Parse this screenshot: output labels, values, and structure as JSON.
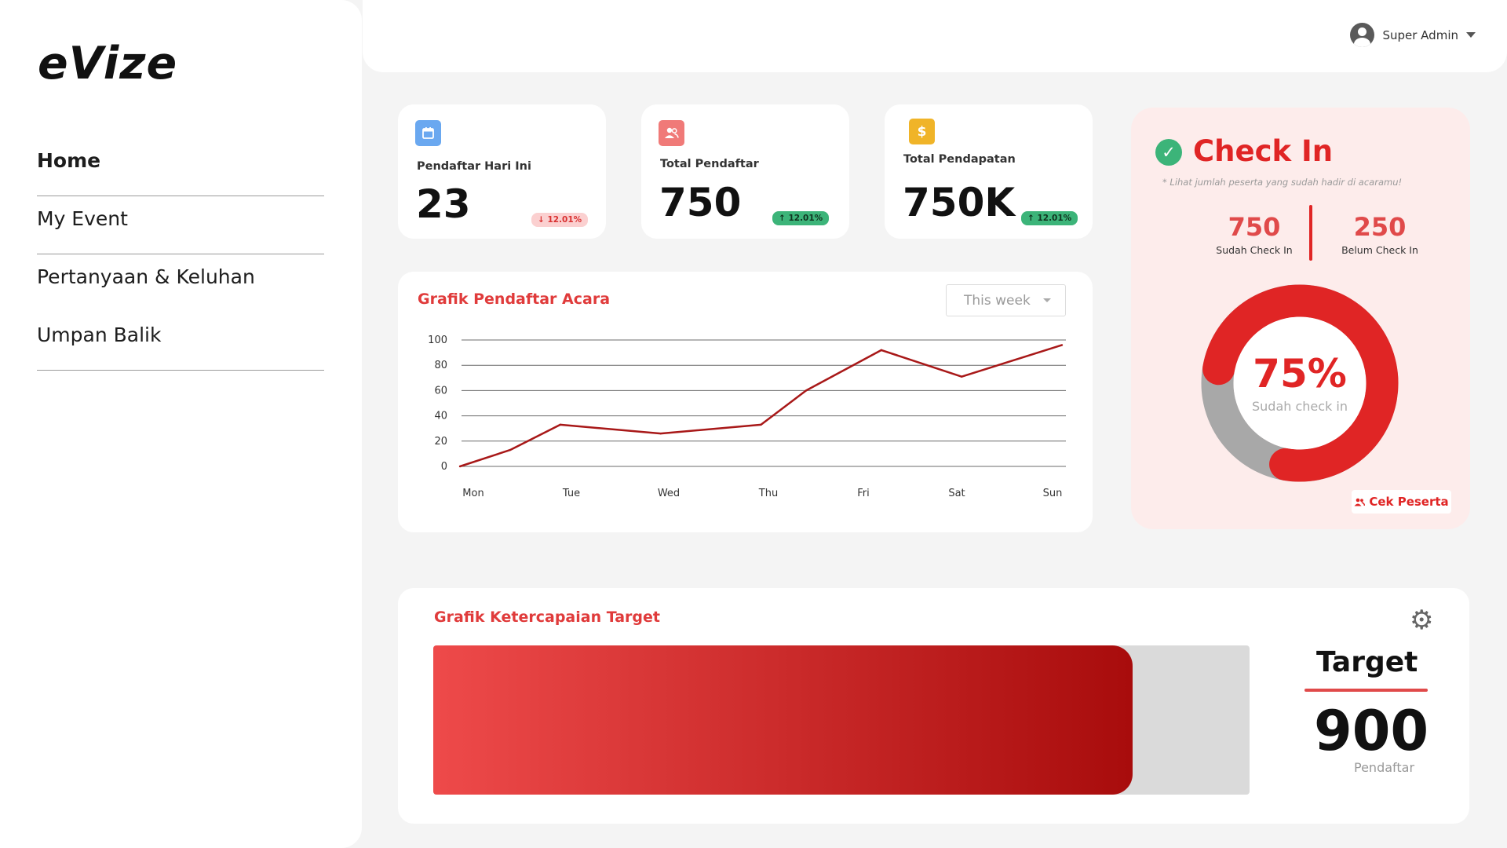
{
  "brand": {
    "logo": "eVize"
  },
  "sidebar": {
    "items": [
      {
        "label": "Home"
      },
      {
        "label": "My Event"
      },
      {
        "label": "Pertanyaan & Keluhan"
      },
      {
        "label": "Umpan Balik"
      }
    ]
  },
  "topbar": {
    "user_name": "Super Admin"
  },
  "stats": [
    {
      "label": "Pendaftar Hari Ini",
      "value": "23",
      "change": "↓ 12.01%",
      "icon": "calendar-icon",
      "color": "#6aa8f0"
    },
    {
      "label": "Total Pendaftar",
      "value": "750",
      "change": "↑ 12.01%",
      "icon": "users-icon",
      "color": "#f07a78"
    },
    {
      "label": "Total Pendapatan",
      "value": "750K",
      "change": "↑ 12.01%",
      "icon": "dollar-icon",
      "color": "#f0b428"
    }
  ],
  "registration_chart": {
    "title": "Grafik Pendaftar Acara",
    "period": "This week"
  },
  "chart_data": {
    "type": "line",
    "categories": [
      "Mon",
      "Tue",
      "Wed",
      "Thu",
      "Fri",
      "Sat",
      "Sun"
    ],
    "x": [
      0,
      0.5,
      1,
      2,
      3,
      3.45,
      4.2,
      5,
      6
    ],
    "values": [
      0,
      13,
      33,
      26,
      33,
      60,
      92,
      71,
      96
    ],
    "yticks": [
      0,
      20,
      40,
      60,
      80,
      100
    ],
    "ylim": [
      0,
      100
    ],
    "line_color": "#a81818",
    "grid": true
  },
  "checkin": {
    "title": "Check In",
    "subtitle": "* Lihat jumlah peserta yang sudah hadir di acaramu!",
    "checked": "750",
    "checked_label": "Sudah Check In",
    "unchecked": "250",
    "unchecked_label": "Belum Check In",
    "percent_text": "75%",
    "percent_label": "Sudah check in",
    "percent": 0.75,
    "button": "Cek Peserta",
    "colors": {
      "done": "#e02525",
      "remaining": "#a8a8a8"
    }
  },
  "target_chart": {
    "title": "Grafik Ketercapaian Target",
    "progress": 0.857,
    "target_label": "Target",
    "target_value": "900",
    "target_unit": "Pendaftar"
  }
}
